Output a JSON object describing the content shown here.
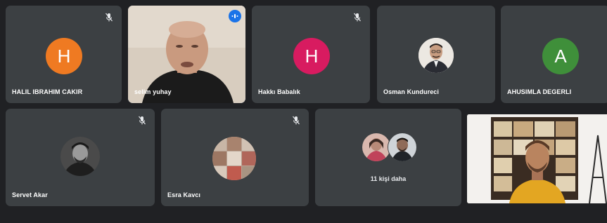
{
  "colors": {
    "background": "#202124",
    "tile": "#3c4043",
    "speaking_outline": "#8ab4f8",
    "avatar_orange": "#ef7a22",
    "avatar_pink": "#d81b60",
    "avatar_green": "#3f8f3a"
  },
  "participants": [
    {
      "name": "HALIL IBRAHIM CAKIR",
      "initial": "H",
      "muted": true
    },
    {
      "name": "selim yuhay",
      "muted": false,
      "speaking": true,
      "video": true
    },
    {
      "name": "Hakkı Babalık",
      "initial": "H",
      "muted": true
    },
    {
      "name": "Osman Kundureci",
      "muted": false,
      "photo": true
    },
    {
      "name": "AHUSIMLA DEGERLI",
      "initial": "A",
      "muted": false
    },
    {
      "name": "Servet Akar",
      "muted": true,
      "photo": true
    },
    {
      "name": "Esra Kavcı",
      "muted": true,
      "photo": true
    }
  ],
  "others": {
    "label": "11 kişi daha"
  },
  "icons": {
    "mic_off": "mic-off-icon",
    "audio_indicator": "audio-level-icon"
  }
}
